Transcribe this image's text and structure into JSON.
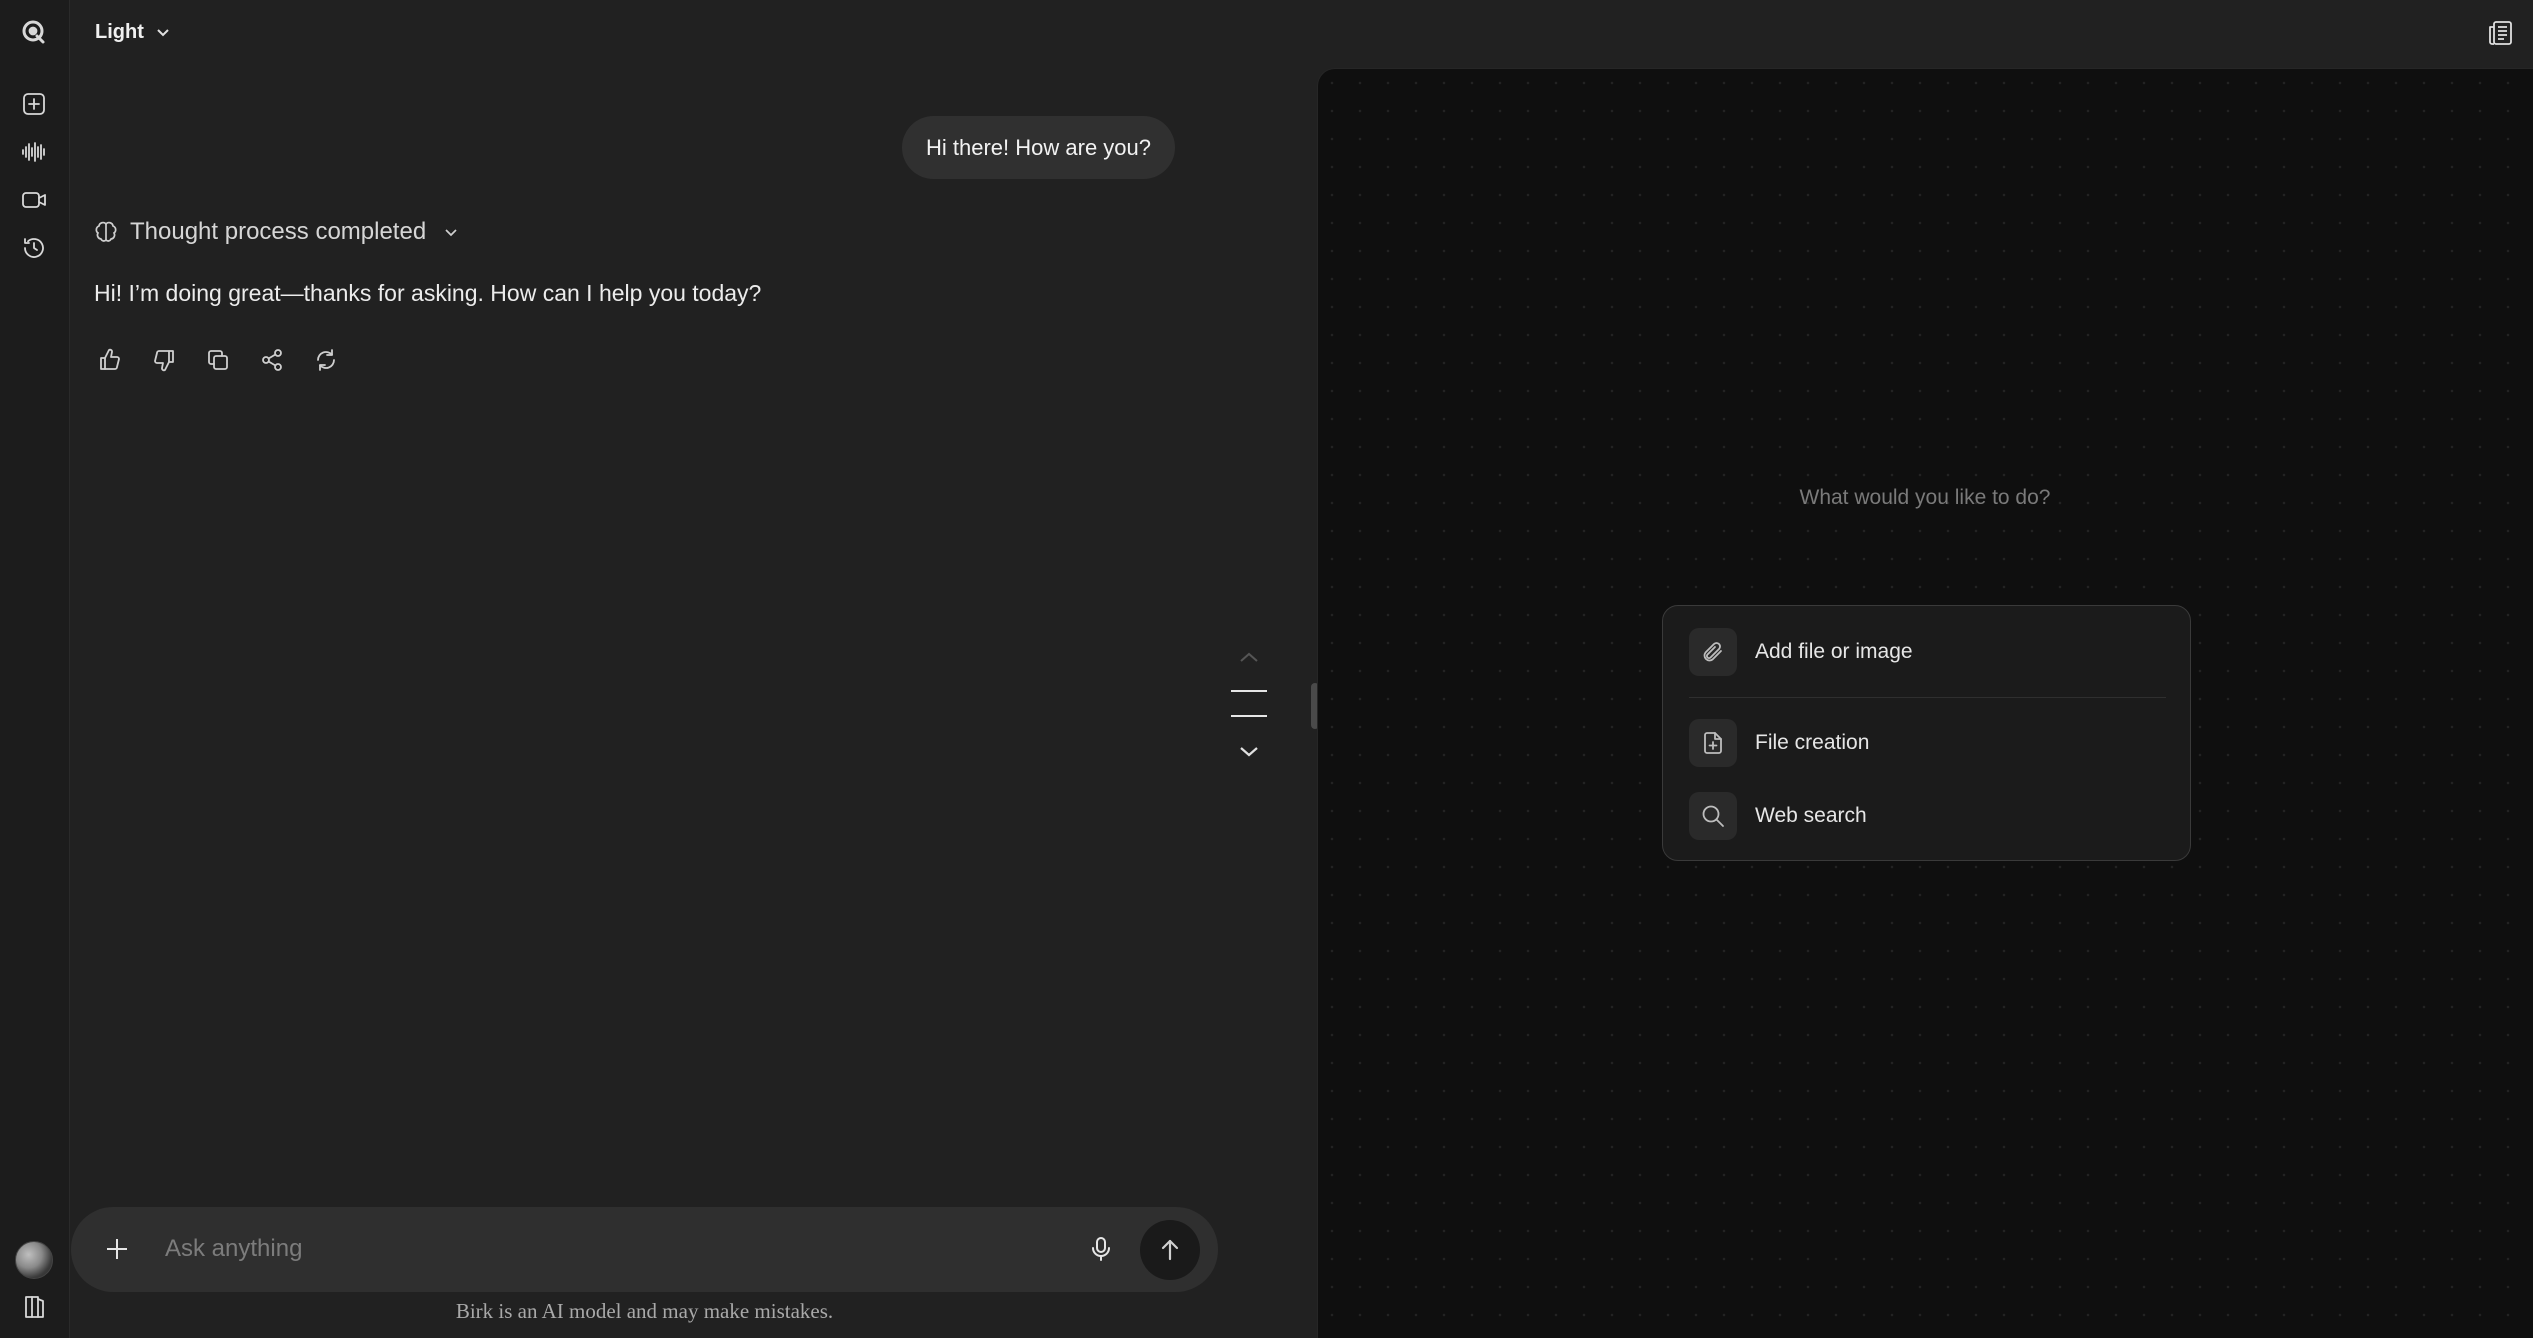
{
  "header": {
    "model_label": "Light"
  },
  "rail": {
    "icons": [
      "logo-icon",
      "new-chat-icon",
      "voice-icon",
      "video-icon",
      "history-icon",
      "avatar",
      "library-icon"
    ]
  },
  "chat": {
    "user_message": "Hi there! How are you?",
    "thought_label": "Thought process completed",
    "assistant_message": "Hi! I’m doing great—thanks for asking. How can I help you today?",
    "actions": [
      "thumbs-up-icon",
      "thumbs-down-icon",
      "copy-icon",
      "share-icon",
      "regenerate-icon"
    ]
  },
  "composer": {
    "placeholder": "Ask anything",
    "disclaimer": "Birk is an AI model and may make mistakes."
  },
  "canvas": {
    "prompt": "What would you like to do?",
    "options": [
      {
        "label": "Add file or image",
        "icon": "paperclip-icon"
      },
      {
        "label": "File creation",
        "icon": "file-plus-icon"
      },
      {
        "label": "Web search",
        "icon": "search-icon"
      }
    ]
  },
  "colors": {
    "background": "#212121",
    "rail": "#1c1c1c",
    "canvas": "#0f0f0f",
    "bubble": "#303030",
    "composer": "#2f2f2f"
  }
}
